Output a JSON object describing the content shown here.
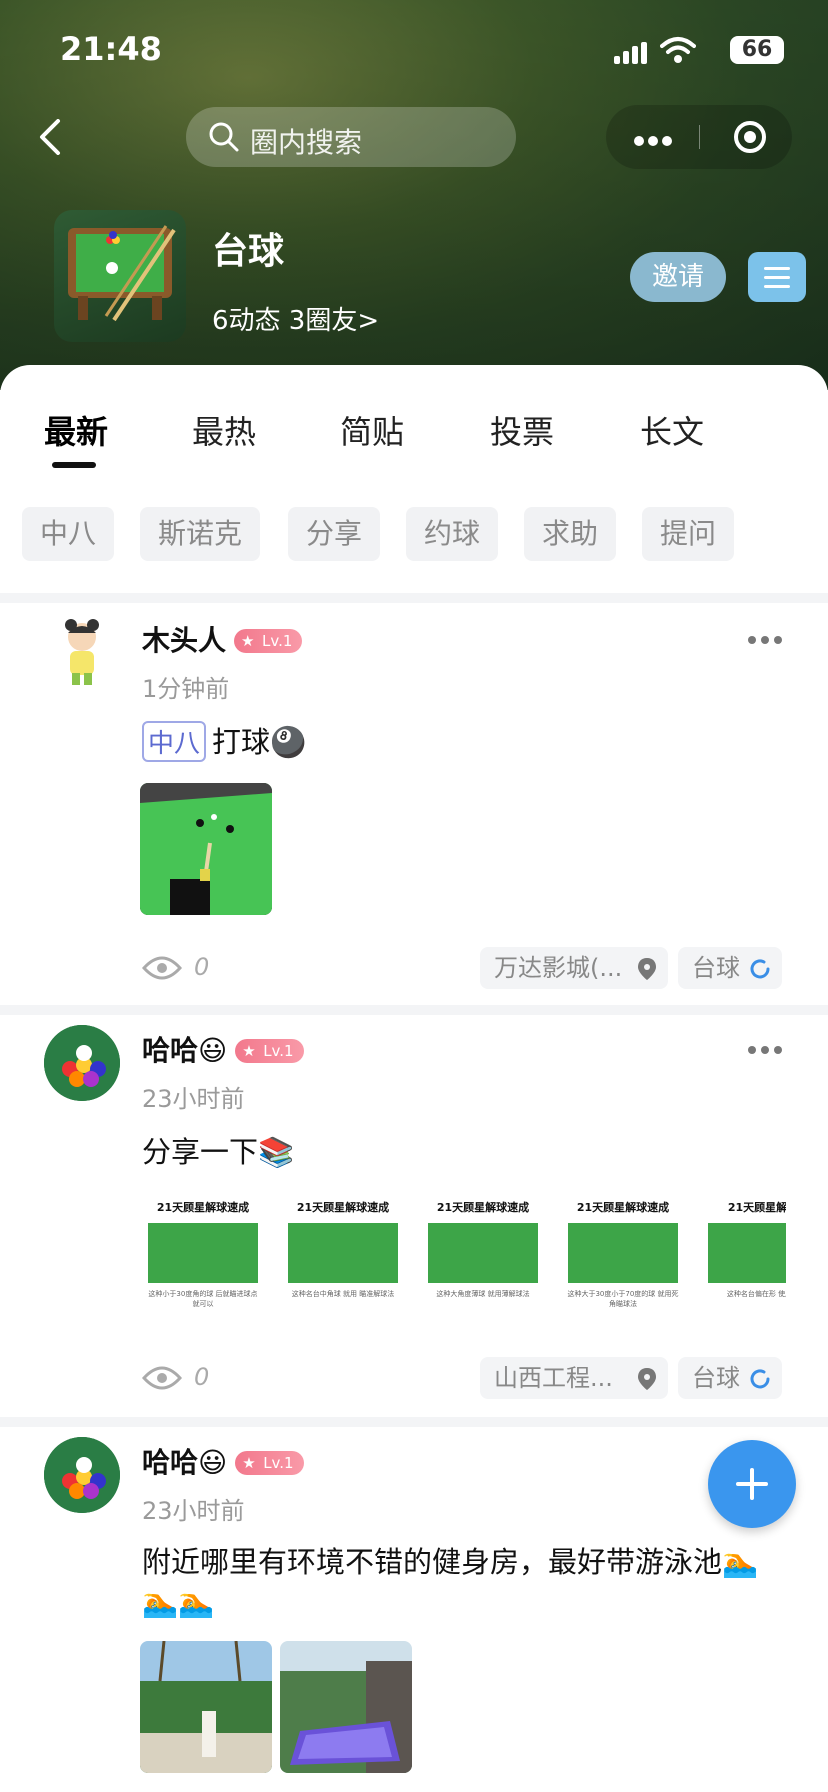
{
  "status_bar": {
    "time": "21:48",
    "battery": "66"
  },
  "nav": {
    "search_placeholder": "圈内搜索"
  },
  "circle": {
    "title": "台球",
    "stats": "6动态 3圈友>",
    "invite_label": "邀请"
  },
  "tabs": [
    "最新",
    "最热",
    "简贴",
    "投票",
    "长文"
  ],
  "active_tab": "最新",
  "chips": [
    "中八",
    "斯诺克",
    "分享",
    "约球",
    "求助",
    "提问"
  ],
  "posts": [
    {
      "user": "木头人",
      "level": "Lv.1",
      "time": "1分钟前",
      "tag": "中八",
      "text": "打球",
      "views": "0",
      "location": "万达影城(...",
      "circle_tag": "台球"
    },
    {
      "user": "哈哈😃",
      "level": "Lv.1",
      "time": "23小时前",
      "text": "分享一下📚",
      "cards": [
        {
          "title": "21天顾星解球速成",
          "caption": "这种小于30度角的球 后就瞄进球点就可以"
        },
        {
          "title": "21天顾星解球速成",
          "caption": "这种名台中角球 就用 瞄准解球法"
        },
        {
          "title": "21天顾星解球速成",
          "caption": "这种大角度薄球 就用薄解球法"
        },
        {
          "title": "21天顾星解球速成",
          "caption": "这种大于30度小于70度的球 就用死角瞄球法"
        },
        {
          "title": "21天顾星解球",
          "caption": "这种名台偏在形 使用背"
        }
      ],
      "views": "0",
      "location": "山西工程...",
      "circle_tag": "台球"
    },
    {
      "user": "哈哈😃",
      "level": "Lv.1",
      "time": "23小时前",
      "text": "附近哪里有环境不错的健身房，最好带游泳池🏊",
      "text2": "🏊🏊"
    }
  ]
}
